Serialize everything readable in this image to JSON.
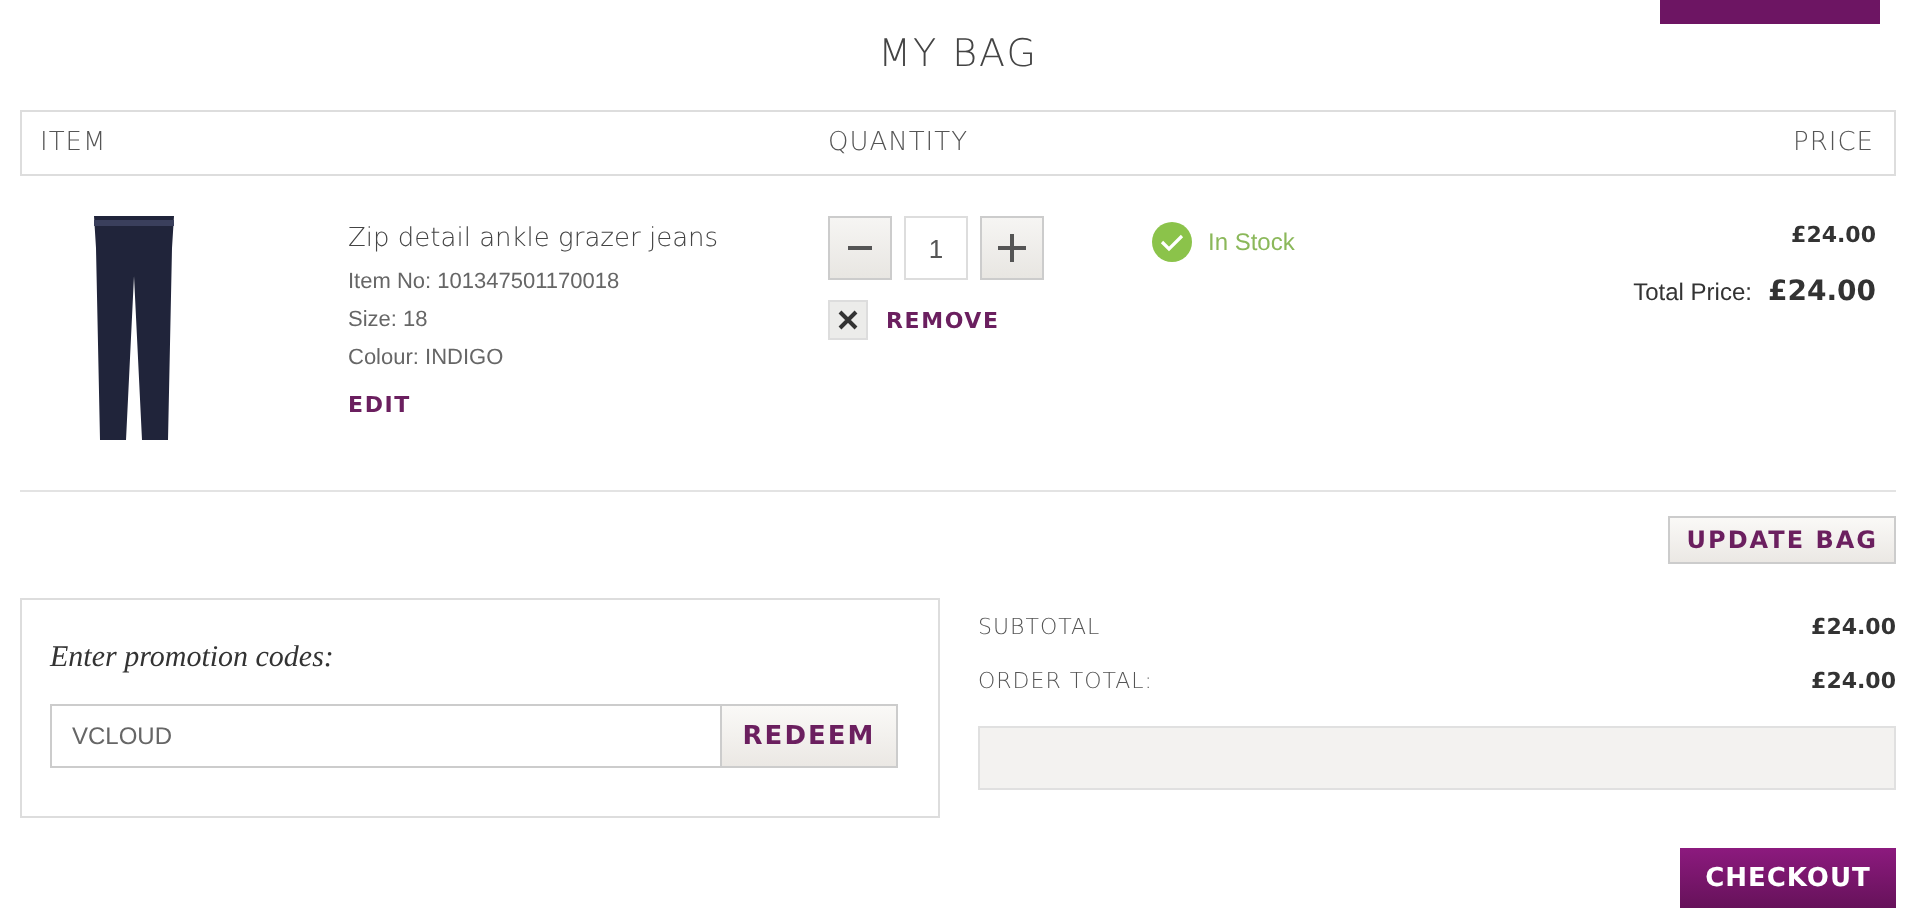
{
  "title": "MY BAG",
  "table": {
    "columns": [
      "ITEM",
      "QUANTITY",
      "PRICE"
    ],
    "rows": [
      {
        "name": "Zip detail ankle grazer jeans",
        "item_no": "Item No: 101347501170018",
        "size": "Size: 18",
        "colour": "Colour: INDIGO",
        "edit": "EDIT",
        "quantity": "1",
        "remove": "REMOVE",
        "stock": "In Stock",
        "price": "£24.00",
        "total_label": "Total Price:",
        "total": "£24.00"
      }
    ]
  },
  "update_button": "UPDATE BAG",
  "promo": {
    "label": "Enter promotion codes:",
    "value": "VCLOUD",
    "button": "REDEEM"
  },
  "summary": [
    {
      "label": "SUBTOTAL",
      "value": "£24.00"
    },
    {
      "label": "ORDER TOTAL:",
      "value": "£24.00"
    }
  ],
  "checkout_button": "CHECKOUT"
}
